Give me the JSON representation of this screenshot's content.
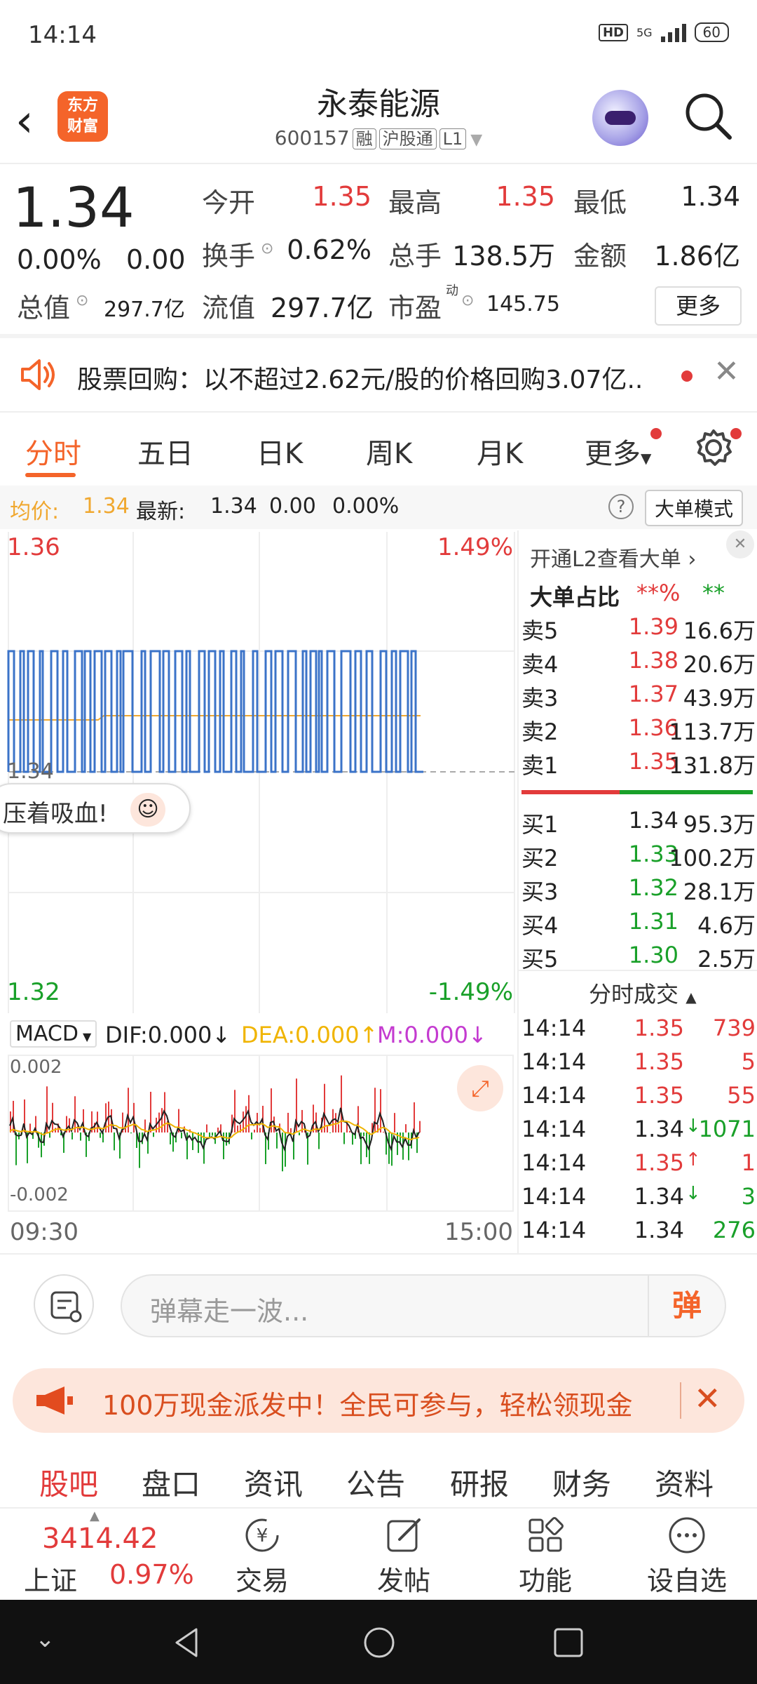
{
  "status": {
    "time": "14:14",
    "hd": "HD",
    "net": "5G",
    "battery": "60"
  },
  "header": {
    "title": "永泰能源",
    "code": "600157",
    "tags": [
      "融",
      "沪股通",
      "L1"
    ],
    "logo_line1": "东方",
    "logo_line2": "财富"
  },
  "quote": {
    "price": "1.34",
    "change_pct": "0.00%",
    "change": "0.00",
    "open_label": "今开",
    "open": "1.35",
    "high_label": "最高",
    "high": "1.35",
    "low_label": "最低",
    "low": "1.34",
    "turnover_label": "换手",
    "turnover": "0.62%",
    "volume_label": "总手",
    "volume": "138.5万",
    "amount_label": "金额",
    "amount": "1.86亿",
    "mktcap_label": "总值",
    "mktcap": "297.7亿",
    "float_label": "流值",
    "float": "297.7亿",
    "pe_label": "市盈",
    "pe_sup": "动",
    "pe": "145.75",
    "more": "更多"
  },
  "notice": {
    "text": "股票回购：以不超过2.62元/股的价格回购3.07亿.."
  },
  "tabs": [
    "分时",
    "五日",
    "日K",
    "周K",
    "月K",
    "更多"
  ],
  "infobar": {
    "avg_label": "均价:",
    "avg": "1.34",
    "latest_label": "最新:",
    "latest": "1.34",
    "chg": "0.00",
    "pct": "0.00%",
    "mode": "大单模式"
  },
  "chart_labels": {
    "y_top": "1.36",
    "y_top_pct": "1.49%",
    "y_mid": "1.34",
    "y_bottom": "1.32",
    "y_bottom_pct": "-1.49%",
    "bubble": "压着吸血!"
  },
  "macd": {
    "name": "MACD",
    "dif": "DIF:0.000",
    "dea": "DEA:0.000",
    "m": "M:0.000",
    "y_top": "0.002",
    "y_bottom": "-0.002",
    "time_start": "09:30",
    "time_end": "15:00"
  },
  "book": {
    "l2": "开通L2查看大单",
    "ratio_label": "大单占比",
    "ratio_sell": "**%",
    "ratio_buy": "**",
    "asks": [
      {
        "label": "卖5",
        "price": "1.39",
        "vol": "16.6万"
      },
      {
        "label": "卖4",
        "price": "1.38",
        "vol": "20.6万"
      },
      {
        "label": "卖3",
        "price": "1.37",
        "vol": "43.9万"
      },
      {
        "label": "卖2",
        "price": "1.36",
        "vol": "113.7万"
      },
      {
        "label": "卖1",
        "price": "1.35",
        "vol": "131.8万"
      }
    ],
    "bids": [
      {
        "label": "买1",
        "price": "1.34",
        "vol": "95.3万"
      },
      {
        "label": "买2",
        "price": "1.33",
        "vol": "100.2万"
      },
      {
        "label": "买3",
        "price": "1.32",
        "vol": "28.1万"
      },
      {
        "label": "买4",
        "price": "1.31",
        "vol": "4.6万"
      },
      {
        "label": "买5",
        "price": "1.30",
        "vol": "2.5万"
      }
    ],
    "trades_title": "分时成交",
    "trades": [
      {
        "time": "14:14",
        "price": "1.35",
        "dir": "",
        "vol": "739",
        "c": "red"
      },
      {
        "time": "14:14",
        "price": "1.35",
        "dir": "",
        "vol": "5",
        "c": "red"
      },
      {
        "time": "14:14",
        "price": "1.35",
        "dir": "",
        "vol": "55",
        "c": "red"
      },
      {
        "time": "14:14",
        "price": "1.34",
        "dir": "↓",
        "vol": "1071",
        "c": "green"
      },
      {
        "time": "14:14",
        "price": "1.35",
        "dir": "↑",
        "vol": "1",
        "c": "red"
      },
      {
        "time": "14:14",
        "price": "1.34",
        "dir": "↓",
        "vol": "3",
        "c": "green"
      },
      {
        "time": "14:14",
        "price": "1.34",
        "dir": "",
        "vol": "276",
        "c": "green"
      }
    ]
  },
  "danmu": {
    "placeholder": "弹幕走一波...",
    "fire": "弹"
  },
  "promo": {
    "text": "100万现金派发中！全民可参与，轻松领现金"
  },
  "sec_tabs": [
    "股吧",
    "盘口",
    "资讯",
    "公告",
    "研报",
    "财务",
    "资料"
  ],
  "bottom": {
    "index_value": "3414.42",
    "index_name": "上证",
    "index_pct": "0.97%",
    "items": [
      "交易",
      "发帖",
      "功能",
      "设自选"
    ]
  },
  "colors": {
    "accent": "#f4642a",
    "up": "#e23b3b",
    "down": "#19a029",
    "line": "#3b73c8",
    "avg": "#f0a830"
  }
}
